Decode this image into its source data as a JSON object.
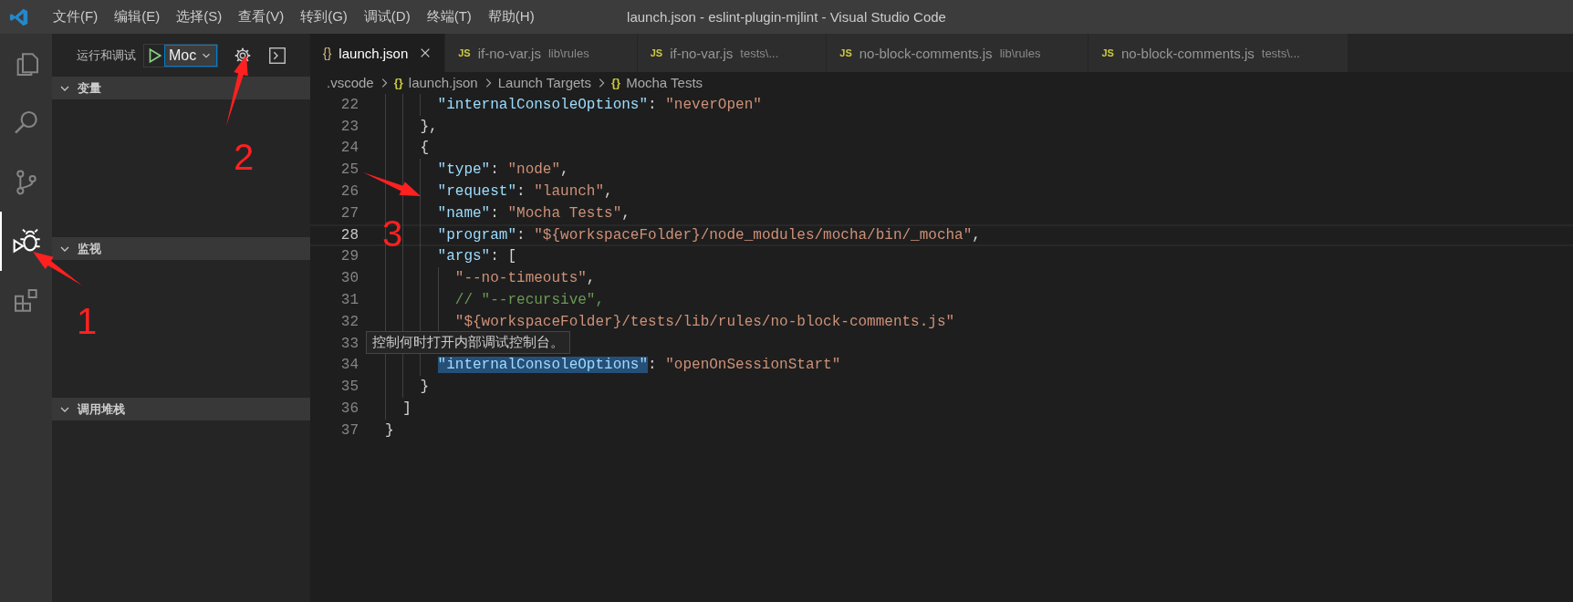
{
  "window": {
    "title": "launch.json - eslint-plugin-mjlint - Visual Studio Code"
  },
  "menu": [
    "文件(F)",
    "编辑(E)",
    "选择(S)",
    "查看(V)",
    "转到(G)",
    "调试(D)",
    "终端(T)",
    "帮助(H)"
  ],
  "activity_bar": [
    {
      "kind": "files",
      "selected": false
    },
    {
      "kind": "search",
      "selected": false
    },
    {
      "kind": "scm",
      "selected": false
    },
    {
      "kind": "debug",
      "selected": true
    },
    {
      "kind": "extensions",
      "selected": false
    }
  ],
  "sidebar": {
    "title": "运行和调试",
    "config_select": {
      "value": "Moc"
    },
    "sections": [
      {
        "title": "变量",
        "expanded": true
      },
      {
        "title": "监视",
        "expanded": true
      },
      {
        "title": "调用堆栈",
        "expanded": true
      }
    ]
  },
  "tabs": [
    {
      "icon": "{}",
      "kind": "json",
      "label": "launch.json",
      "selected": true
    },
    {
      "icon": "JS",
      "kind": "js",
      "label": "if-no-var.js",
      "description": "lib\\rules",
      "selected": false
    },
    {
      "icon": "JS",
      "kind": "js",
      "label": "if-no-var.js",
      "description": "tests\\...",
      "selected": false
    },
    {
      "icon": "JS",
      "kind": "js",
      "label": "no-block-comments.js",
      "description": "lib\\rules",
      "selected": false
    },
    {
      "icon": "JS",
      "kind": "js",
      "label": "no-block-comments.js",
      "description": "tests\\...",
      "selected": false
    }
  ],
  "breadcrumbs": [
    {
      "label": ".vscode"
    },
    {
      "icon": "{}",
      "label": "launch.json"
    },
    {
      "label": "Launch Targets"
    },
    {
      "icon": "{}",
      "label": "Mocha Tests"
    }
  ],
  "code_lines": [
    {
      "number": "22",
      "current": false,
      "tokens": [
        {
          "kind": "key",
          "text": "      \"internalConsoleOptions\""
        },
        {
          "text": ": "
        },
        {
          "kind": "string",
          "text": "\"neverOpen\""
        }
      ]
    },
    {
      "number": "23",
      "current": false,
      "tokens": [
        {
          "text": "    },"
        }
      ]
    },
    {
      "number": "24",
      "current": false,
      "tokens": [
        {
          "text": "    {"
        }
      ]
    },
    {
      "number": "25",
      "current": false,
      "tokens": [
        {
          "kind": "key",
          "text": "      \"type\""
        },
        {
          "text": ": "
        },
        {
          "kind": "string",
          "text": "\"node\""
        },
        {
          "text": ","
        }
      ]
    },
    {
      "number": "26",
      "current": false,
      "tokens": [
        {
          "kind": "key",
          "text": "      \"request\""
        },
        {
          "text": ": "
        },
        {
          "kind": "string",
          "text": "\"launch\""
        },
        {
          "text": ","
        }
      ]
    },
    {
      "number": "27",
      "current": false,
      "tokens": [
        {
          "kind": "key",
          "text": "      \"name\""
        },
        {
          "text": ": "
        },
        {
          "kind": "string",
          "text": "\"Mocha Tests\""
        },
        {
          "text": ","
        }
      ]
    },
    {
      "number": "28",
      "current": true,
      "tokens": [
        {
          "kind": "key",
          "text": "      \"program\""
        },
        {
          "text": ": "
        },
        {
          "kind": "string",
          "text": "\"${workspaceFolder}/node_modules/mocha/bin/_mocha\""
        },
        {
          "text": ","
        }
      ]
    },
    {
      "number": "29",
      "current": false,
      "tokens": [
        {
          "kind": "key",
          "text": "      \"args\""
        },
        {
          "text": ": ["
        }
      ]
    },
    {
      "number": "30",
      "current": false,
      "tokens": [
        {
          "kind": "string",
          "text": "        \"--no-timeouts\""
        },
        {
          "text": ","
        }
      ]
    },
    {
      "number": "31",
      "current": false,
      "tokens": [
        {
          "kind": "comment",
          "text": "        // \"--recursive\","
        }
      ]
    },
    {
      "number": "32",
      "current": false,
      "tokens": [
        {
          "kind": "string",
          "text": "        \"${workspaceFolder}/tests/lib/rules/no-block-comments.js\""
        }
      ]
    },
    {
      "number": "33",
      "current": false,
      "tooltip": "控制何时打开内部调试控制台。"
    },
    {
      "number": "34",
      "current": false,
      "tokens": [
        {
          "kind": "key",
          "text": "      \"internalConsoleOptions\"",
          "highlighted": true
        },
        {
          "text": ": "
        },
        {
          "kind": "string",
          "text": "\"openOnSessionStart\""
        }
      ]
    },
    {
      "number": "35",
      "current": false,
      "tokens": [
        {
          "text": "    }"
        }
      ]
    },
    {
      "number": "36",
      "current": false,
      "tokens": [
        {
          "text": "  ]"
        }
      ]
    },
    {
      "number": "37",
      "current": false,
      "tokens": [
        {
          "text": "}"
        }
      ]
    }
  ],
  "annotations": [
    {
      "kind": "arrow",
      "label": "1"
    },
    {
      "kind": "arrow",
      "label": "2"
    },
    {
      "kind": "arrow",
      "label": "3"
    }
  ]
}
